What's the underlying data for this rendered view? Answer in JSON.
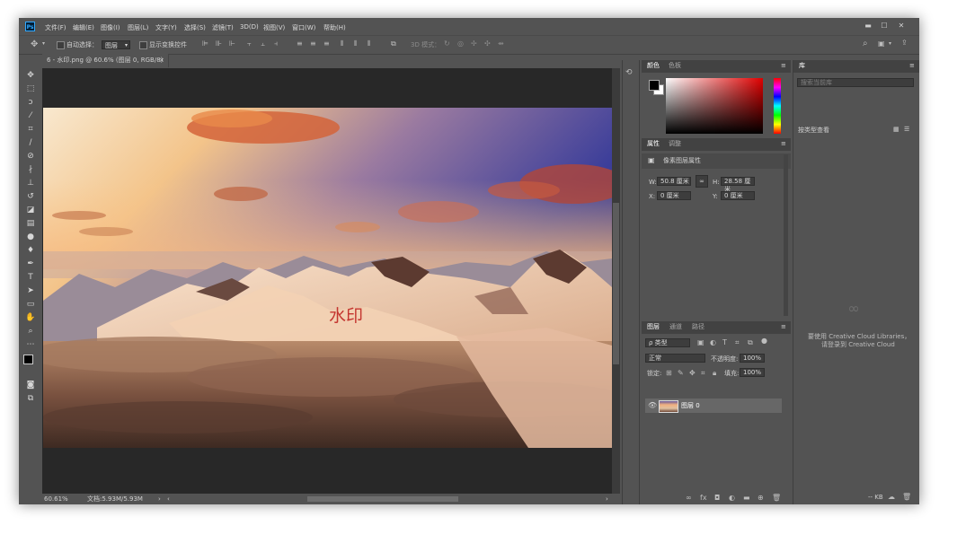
{
  "app": {
    "logo": "Ps",
    "menu": [
      "文件(F)",
      "编辑(E)",
      "图像(I)",
      "图层(L)",
      "文字(Y)",
      "选择(S)",
      "滤镜(T)",
      "3D(D)",
      "视图(V)",
      "窗口(W)",
      "帮助(H)"
    ],
    "window_controls": {
      "minimize": "▬",
      "maximize": "☐",
      "close": "✕"
    }
  },
  "options_bar": {
    "auto_select_label": "自动选择：",
    "auto_select_value": "图层",
    "show_transform_label": "显示变换控件",
    "mode_3d_label": "3D 模式："
  },
  "document": {
    "tab_title": "6 - 水印.png @ 60.6% (图层 0, RGB/8)",
    "watermark_text": "水印",
    "zoom": "60.61%",
    "doc_info": "文档:5.93M/5.93M"
  },
  "color_panel": {
    "tabs": [
      "颜色",
      "色板"
    ],
    "foreground": "#000000",
    "background": "#ffffff"
  },
  "properties_panel": {
    "tabs": [
      "属性",
      "调整"
    ],
    "section_title": "像素图层属性",
    "w_label": "W:",
    "w_value": "50.8 厘米",
    "h_label": "H:",
    "h_value": "28.58 厘米",
    "x_label": "X:",
    "x_value": "0 厘米",
    "y_label": "Y:",
    "y_value": "0 厘米"
  },
  "layers_panel": {
    "tabs": [
      "图层",
      "通道",
      "路径"
    ],
    "filter_kind": "ρ 类型",
    "blend_mode": "正常",
    "opacity_label": "不透明度:",
    "opacity_value": "100%",
    "lock_label": "锁定:",
    "fill_label": "填充:",
    "fill_value": "100%",
    "layers": [
      {
        "name": "图层 0"
      }
    ]
  },
  "library_panel": {
    "tab": "库",
    "search_placeholder": "搜索当前库",
    "view_by": "按类型查看",
    "message_line1": "要使用 Creative Cloud Libraries，",
    "message_line2": "请登录到 Creative Cloud",
    "size_label": "-- KB"
  }
}
